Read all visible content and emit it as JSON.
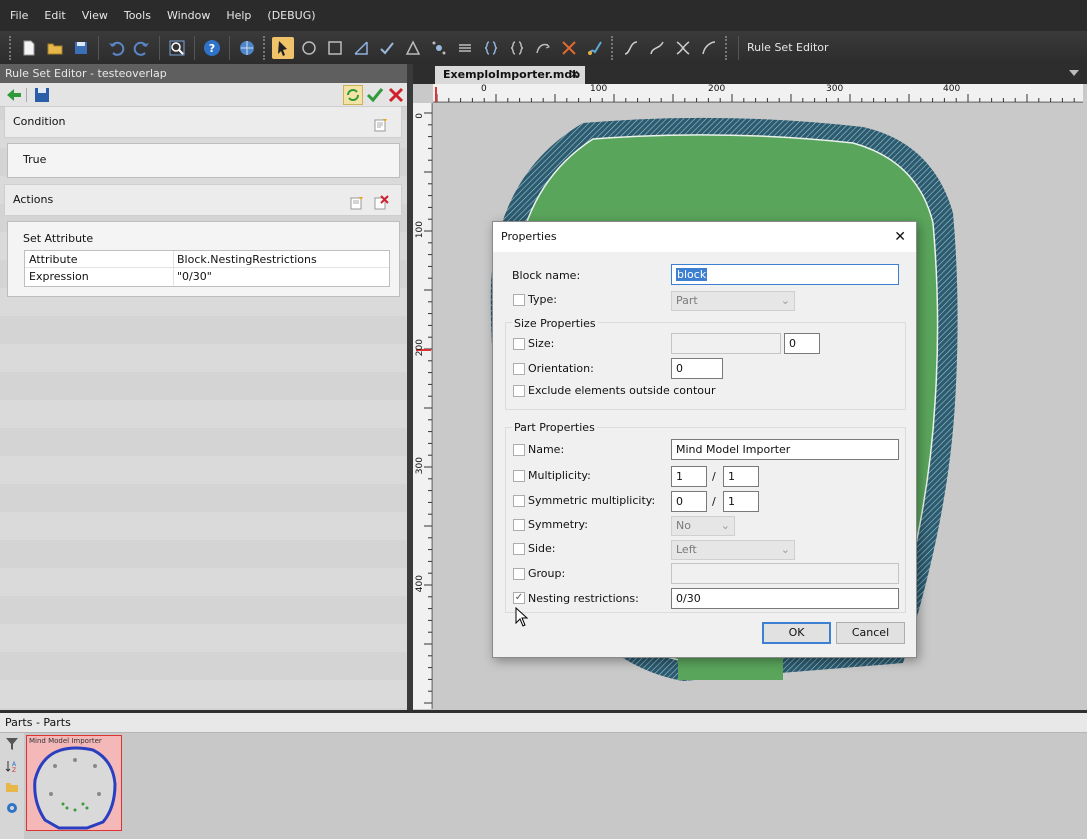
{
  "menu": [
    "File",
    "Edit",
    "View",
    "Tools",
    "Window",
    "Help",
    "(DEBUG)"
  ],
  "toolbar": {
    "icons": [
      "new-file-icon",
      "open-folder-icon",
      "save-icon",
      "undo-icon",
      "redo-icon",
      "zoom-icon",
      "help-icon",
      "globe-icon",
      "select-arrow-icon",
      "rotate-icon",
      "frame-icon",
      "measure-icon",
      "check-tool-icon",
      "triangle-tool-icon",
      "node-tool-icon",
      "align-tool-icon",
      "brace-tool-icon",
      "brace2-tool-icon",
      "curve-tool-icon",
      "cut-tool-icon",
      "brush-icon",
      "curve-a-icon",
      "curve-b-icon",
      "curve-x-icon",
      "curve-c-icon"
    ],
    "rule_set_editor_label": "Rule Set Editor"
  },
  "rule_editor": {
    "title": "Rule Set Editor - testeoverlap",
    "condition_label": "Condition",
    "condition_value": "True",
    "actions_label": "Actions",
    "action_name": "Set Attribute",
    "rows": [
      {
        "key": "Attribute",
        "value": "Block.NestingRestrictions"
      },
      {
        "key": "Expression",
        "value": "\"0/30\""
      }
    ]
  },
  "document": {
    "tab_label": "ExemploImporter.mdb",
    "close_glyph": "✕",
    "ruler_h": [
      "0",
      "100",
      "200",
      "300",
      "400"
    ],
    "ruler_v": [
      "0",
      "100",
      "200",
      "300",
      "400"
    ]
  },
  "parts_panel": {
    "title": "Parts - Parts",
    "part_label": "Mind Model Importer"
  },
  "dialog": {
    "title": "Properties",
    "close_glyph": "✕",
    "block_name_label": "Block name:",
    "block_name_value": "block",
    "type_label": "Type:",
    "type_value": "Part",
    "size_group": "Size Properties",
    "size_label": "Size:",
    "size_value2": "0",
    "orientation_label": "Orientation:",
    "orientation_value": "0",
    "exclude_label": "Exclude elements outside contour",
    "part_group": "Part Properties",
    "name_label": "Name:",
    "name_value": "Mind Model Importer",
    "multiplicity_label": "Multiplicity:",
    "multiplicity_a": "1",
    "multiplicity_b": "1",
    "sym_mult_label": "Symmetric multiplicity:",
    "sym_mult_a": "0",
    "sym_mult_b": "1",
    "slash": "/",
    "symmetry_label": "Symmetry:",
    "symmetry_value": "No",
    "side_label": "Side:",
    "side_value": "Left",
    "group_label": "Group:",
    "nesting_label": "Nesting restrictions:",
    "nesting_value": "0/30",
    "nesting_checked": true,
    "ok_label": "OK",
    "cancel_label": "Cancel"
  }
}
